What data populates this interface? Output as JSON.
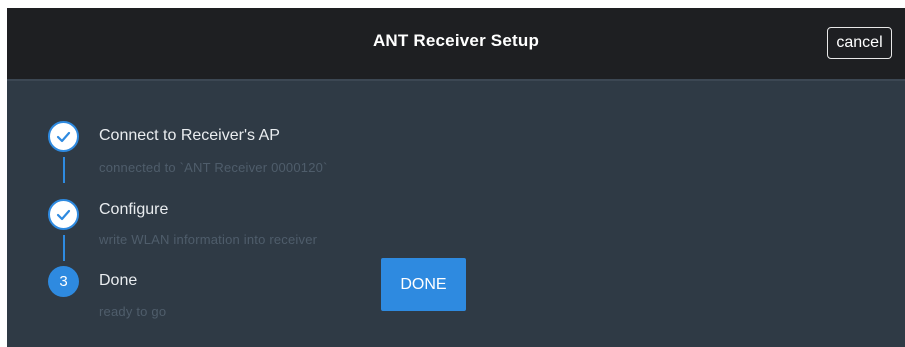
{
  "header": {
    "title": "ANT Receiver Setup",
    "cancel_label": "cancel"
  },
  "steps": [
    {
      "title": "Connect to Receiver's AP",
      "subtitle": "connected to `ANT Receiver 0000120`",
      "status": "done",
      "icon": "check-icon"
    },
    {
      "title": "Configure",
      "subtitle": "write WLAN information into receiver",
      "status": "done",
      "icon": "check-icon"
    },
    {
      "title": "Done",
      "subtitle": "ready to go",
      "status": "active",
      "number": "3"
    }
  ],
  "actions": {
    "done_label": "DONE"
  },
  "colors": {
    "accent": "#2e8ae0",
    "header_bg": "#1e1f22",
    "body_bg": "#2f3a45"
  }
}
